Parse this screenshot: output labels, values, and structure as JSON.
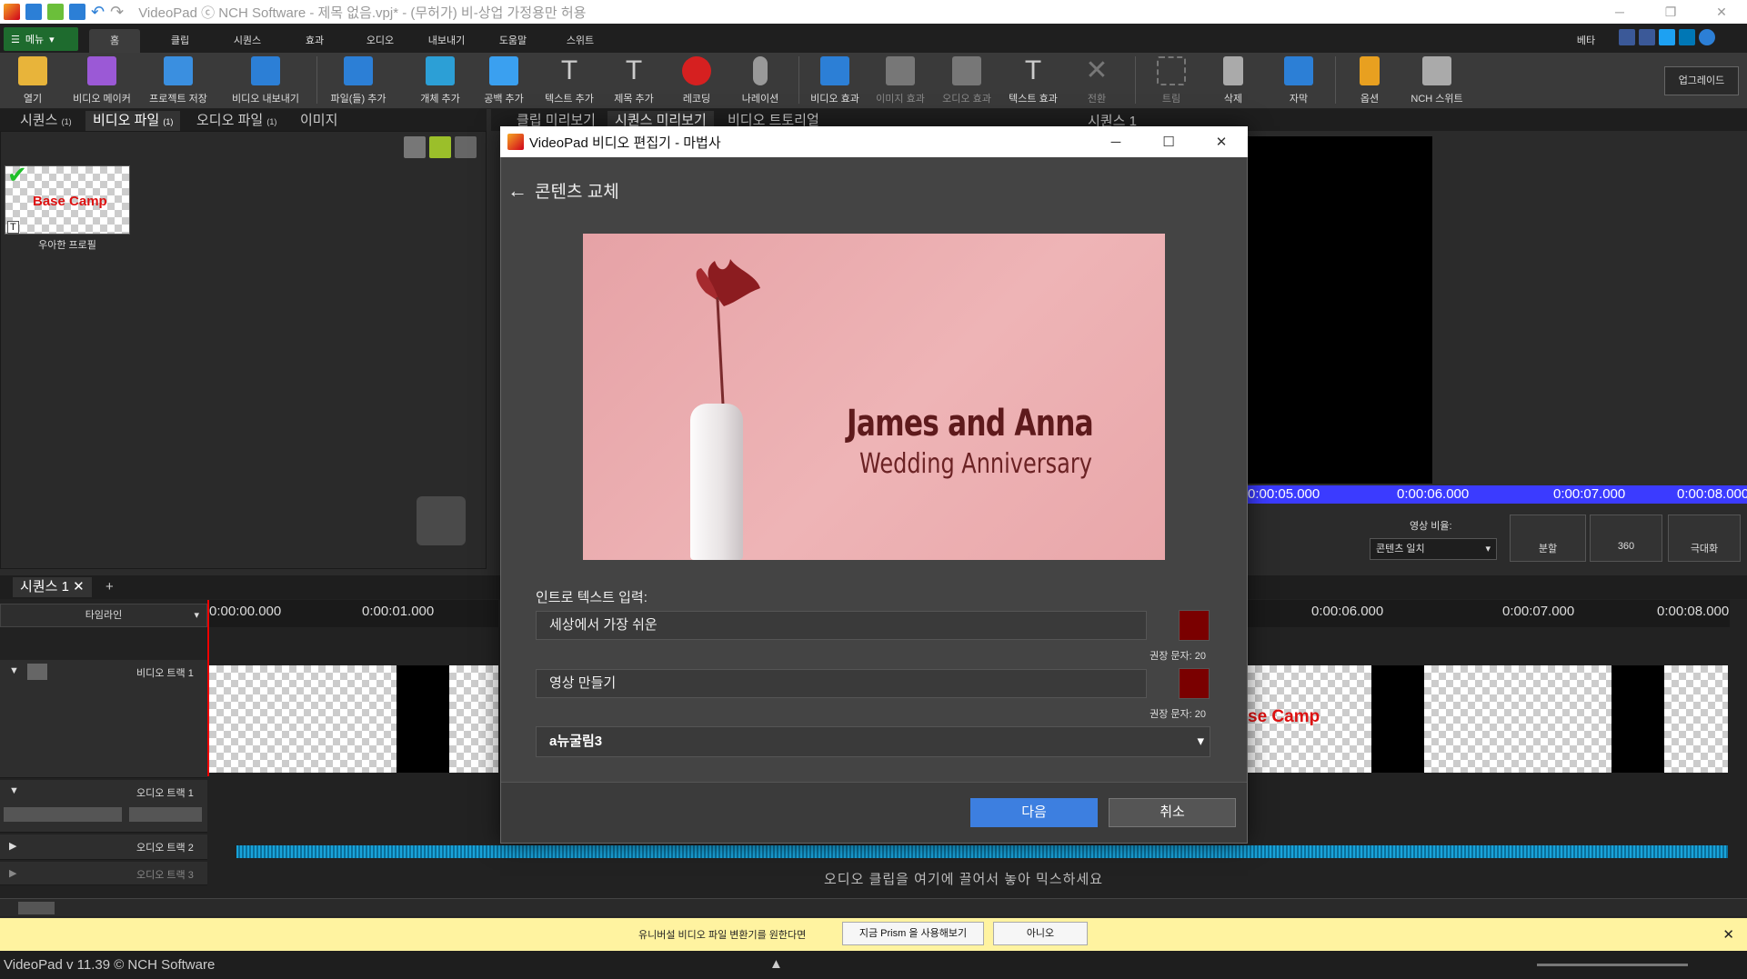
{
  "app": {
    "title": "VideoPad ⓒ NCH Software - 제목 없음.vpj* - (무허가) 비-상업 가정용만 허용",
    "beta": "베타"
  },
  "menu": {
    "menu_button": "메뉴",
    "tabs": [
      "홈",
      "클립",
      "시퀀스",
      "효과",
      "오디오",
      "내보내기",
      "도움말",
      "스위트"
    ]
  },
  "toolbar": {
    "items": [
      {
        "label": "열기",
        "icon": "folder-open-icon",
        "color": "#e8b43a"
      },
      {
        "label": "비디오 메이커",
        "icon": "wizard-icon",
        "color": "#9b59d6"
      },
      {
        "label": "프로젝트 저장",
        "icon": "save-icon",
        "color": "#3a8fe0"
      },
      {
        "label": "비디오 내보내기",
        "icon": "export-video-icon",
        "color": "#2c7fd6"
      },
      {
        "label": "파일(들) 추가",
        "icon": "add-files-icon",
        "color": "#2c7fd6"
      },
      {
        "label": "개체 추가",
        "icon": "add-object-icon",
        "color": "#2c9fd6"
      },
      {
        "label": "공백 추가",
        "icon": "add-blank-icon",
        "color": "#3aa0f0"
      },
      {
        "label": "텍스트 추가",
        "icon": "add-text-icon",
        "color": "#cccccc"
      },
      {
        "label": "제목 추가",
        "icon": "add-title-icon",
        "color": "#cccccc"
      },
      {
        "label": "레코딩",
        "icon": "record-icon",
        "color": "#d62020"
      },
      {
        "label": "나레이션",
        "icon": "microphone-icon",
        "color": "#bbbbbb"
      },
      {
        "label": "비디오 효과",
        "icon": "video-fx-icon",
        "color": "#2c7fd6"
      },
      {
        "label": "이미지 효과",
        "icon": "image-fx-icon",
        "color": "#777777"
      },
      {
        "label": "오디오 효과",
        "icon": "audio-fx-icon",
        "color": "#777777"
      },
      {
        "label": "텍스트 효과",
        "icon": "text-fx-icon",
        "color": "#cccccc"
      },
      {
        "label": "전환",
        "icon": "transition-icon",
        "color": "#777777"
      },
      {
        "label": "트림",
        "icon": "trim-icon",
        "color": "#777777"
      },
      {
        "label": "삭제",
        "icon": "trash-icon",
        "color": "#bbbbbb"
      },
      {
        "label": "자막",
        "icon": "subtitle-icon",
        "color": "#2c7fd6"
      },
      {
        "label": "옵션",
        "icon": "options-icon",
        "color": "#e8a020"
      },
      {
        "label": "NCH 스위트",
        "icon": "nch-suite-icon",
        "color": "#bbbbbb"
      }
    ],
    "upgrade": "업그레이드"
  },
  "bin": {
    "tabs": [
      "시퀀스",
      "비디오 파일",
      "오디오 파일",
      "이미지"
    ],
    "tab_counts": [
      "(1)",
      "(1)",
      "(1)",
      ""
    ],
    "thumb_label": "우아한 프로필",
    "thumb_title": "Base Camp"
  },
  "preview": {
    "tabs": [
      "클립 미리보기",
      "시퀀스 미리보기",
      "비디오 트토리얼"
    ],
    "seq_label": "시퀀스 1",
    "ruler": [
      "0:00:05.000",
      "0:00:06.000",
      "0:00:07.000",
      "0:00:08.000"
    ],
    "aspect_label": "영상 비율:",
    "aspect_value": "콘텐츠 일치",
    "split": "분할",
    "btn_360": "360",
    "maximize": "극대화"
  },
  "sequence": {
    "tab": "시퀀스 1",
    "timeline_mode": "타임라인",
    "ruler_left": [
      "0:00:00.000",
      "0:00:01.000"
    ],
    "ruler_right": [
      "0:00:06.000",
      "0:00:07.000",
      "0:00:08.000"
    ],
    "video_track": "비디오 트랙 1",
    "audio_track1": "오디오 트랙 1",
    "audio_track2": "오디오 트랙 2",
    "audio_track3": "오디오 트랙 3",
    "drop_hint": "오디오 클립을 여기에 끌어서 놓아 믹스하세요",
    "clip_text": "se Camp"
  },
  "dialog": {
    "title": "VideoPad 비디오 편집기 - 마법사",
    "heading": "콘텐츠 교체",
    "image_line1": "James and Anna",
    "image_line2": "Wedding Anniversary",
    "intro_label": "인트로 텍스트 입력:",
    "field1": "세상에서 가장 쉬운",
    "field2": "영상 만들기",
    "hint": "권장 문자: 20",
    "font": "a뉴굴림3",
    "next": "다음",
    "cancel": "취소",
    "swatch_color": "#7a0000"
  },
  "notify": {
    "text": "유니버설 비디오 파일 변환기를 원한다면",
    "prism": "지금 Prism 을 사용해보기",
    "no": "아니오"
  },
  "status": {
    "version": "VideoPad v 11.39 © NCH Software"
  }
}
